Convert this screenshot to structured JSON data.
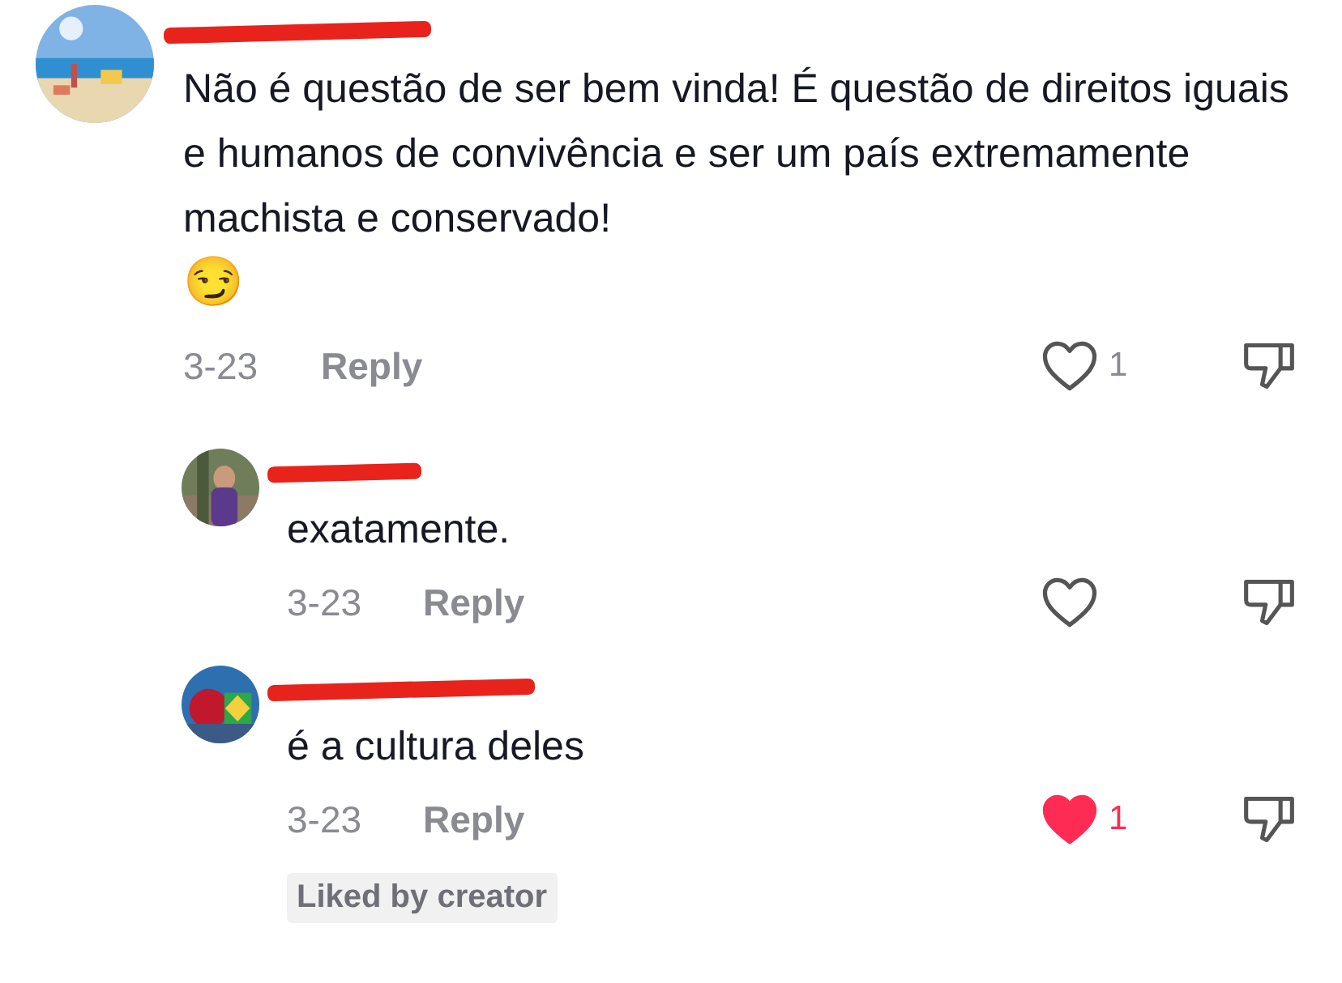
{
  "comments": [
    {
      "text": "Não é questão de ser bem vinda! É questão de direitos iguais e humanos de convivência e ser um país extremamente machista e conservado!",
      "emoji": "😏",
      "date": "3-23",
      "reply_label": "Reply",
      "liked": false,
      "like_count": "1",
      "replies": [
        {
          "text": "exatamente.",
          "date": "3-23",
          "reply_label": "Reply",
          "liked": false
        },
        {
          "text": "é a cultura deles",
          "date": "3-23",
          "reply_label": "Reply",
          "liked": true,
          "like_count": "1",
          "badge": "Liked by creator"
        }
      ]
    }
  ]
}
